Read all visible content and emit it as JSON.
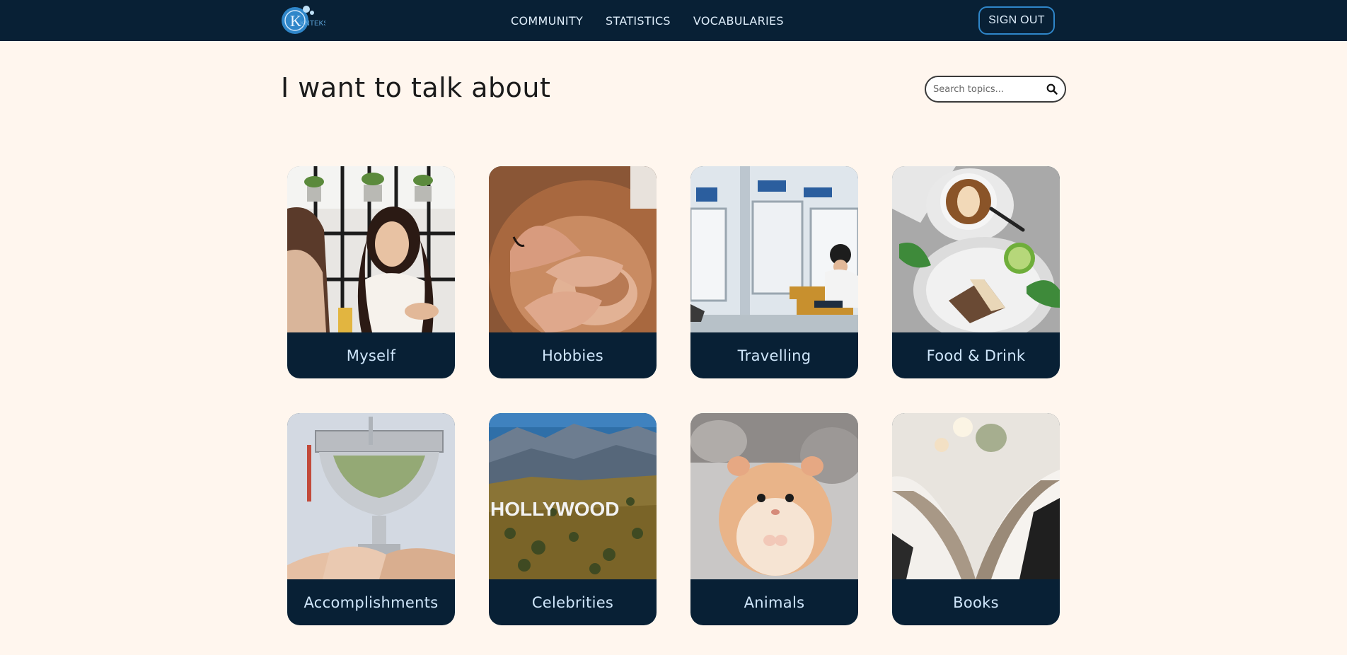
{
  "app": {
    "logo_text": "KNTEKS"
  },
  "nav": {
    "links": [
      "COMMUNITY",
      "STATISTICS",
      "VOCABULARIES"
    ],
    "sign_out_label": "SIGN OUT"
  },
  "main": {
    "title": "I want to talk about",
    "search_placeholder": "Search topics...",
    "search_icon": "search-icon"
  },
  "topics": [
    {
      "label": "Myself",
      "image": "two-women-talking"
    },
    {
      "label": "Hobbies",
      "image": "pottery-wheel"
    },
    {
      "label": "Travelling",
      "image": "train-interior"
    },
    {
      "label": "Food & Drink",
      "image": "coffee-and-cake"
    },
    {
      "label": "Accomplishments",
      "image": "trophy-hands"
    },
    {
      "label": "Celebrities",
      "image": "hollywood-sign"
    },
    {
      "label": "Animals",
      "image": "hamster"
    },
    {
      "label": "Books",
      "image": "open-book"
    }
  ],
  "colors": {
    "navbar": "#082035",
    "page_bg": "#fff6ee",
    "card_label_bg": "#082035",
    "accent": "#2f86c9"
  }
}
